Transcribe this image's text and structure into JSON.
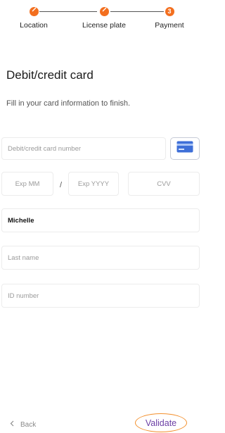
{
  "stepper": {
    "steps": [
      {
        "label": "Location",
        "state": "done"
      },
      {
        "label": "License plate",
        "state": "done"
      },
      {
        "label": "Payment",
        "state": "current",
        "number": "3"
      }
    ],
    "accent_color": "#f36f1f"
  },
  "header": {
    "title": "Debit/credit card",
    "subtitle": "Fill in your card information to finish."
  },
  "form": {
    "card_number": {
      "placeholder": "Debit/credit card number",
      "value": ""
    },
    "card_icon": "credit-card-icon",
    "exp_month": {
      "placeholder": "Exp MM",
      "value": ""
    },
    "separator": "/",
    "exp_year": {
      "placeholder": "Exp YYYY",
      "value": ""
    },
    "cvv": {
      "placeholder": "CVV",
      "value": ""
    },
    "first_name": {
      "placeholder": "",
      "value": "Michelle"
    },
    "last_name": {
      "placeholder": "Last name",
      "value": ""
    },
    "id_number": {
      "placeholder": "ID number",
      "value": ""
    }
  },
  "footer": {
    "back_label": "Back",
    "validate_label": "Validate",
    "validate_color": "#6b3fa5",
    "highlight_color": "#f3902d"
  }
}
